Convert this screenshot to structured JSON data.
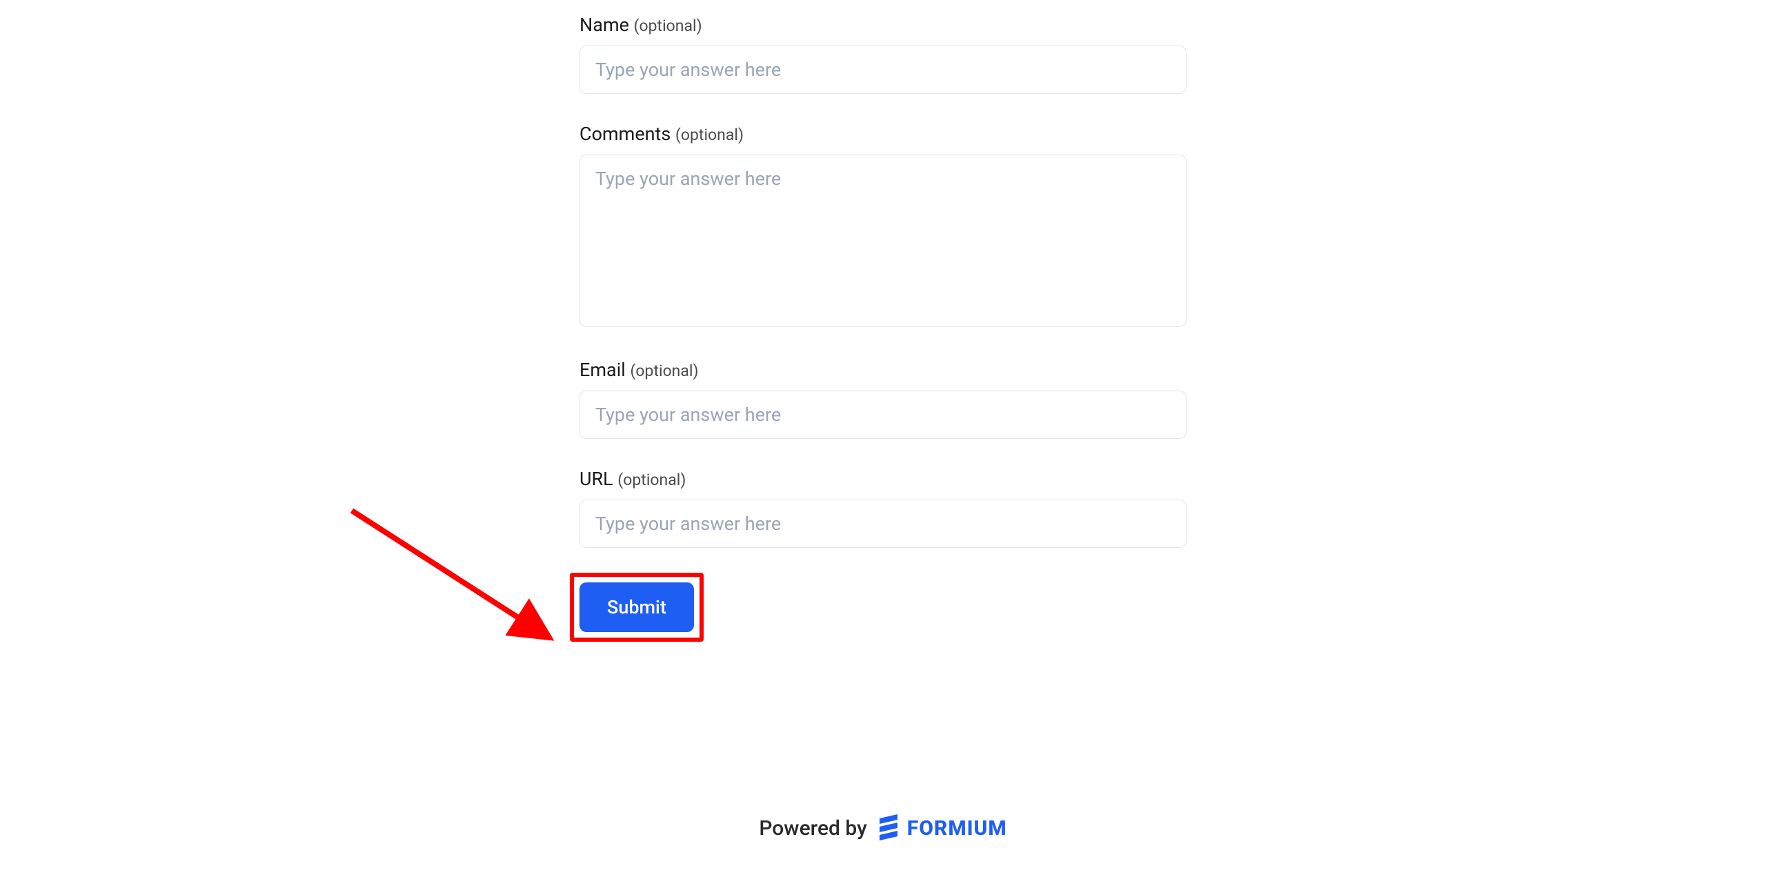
{
  "form": {
    "fields": [
      {
        "label": "Name",
        "optional": "(optional)",
        "placeholder": "Type your answer here",
        "type": "text"
      },
      {
        "label": "Comments",
        "optional": "(optional)",
        "placeholder": "Type your answer here",
        "type": "textarea"
      },
      {
        "label": "Email",
        "optional": "(optional)",
        "placeholder": "Type your answer here",
        "type": "text"
      },
      {
        "label": "URL",
        "optional": "(optional)",
        "placeholder": "Type your answer here",
        "type": "text"
      }
    ],
    "submit_label": "Submit"
  },
  "footer": {
    "powered_by": "Powered by",
    "brand": "FORMIUM"
  },
  "annotation": {
    "arrow_color": "#ff0000",
    "highlight_color": "#ff0000"
  }
}
